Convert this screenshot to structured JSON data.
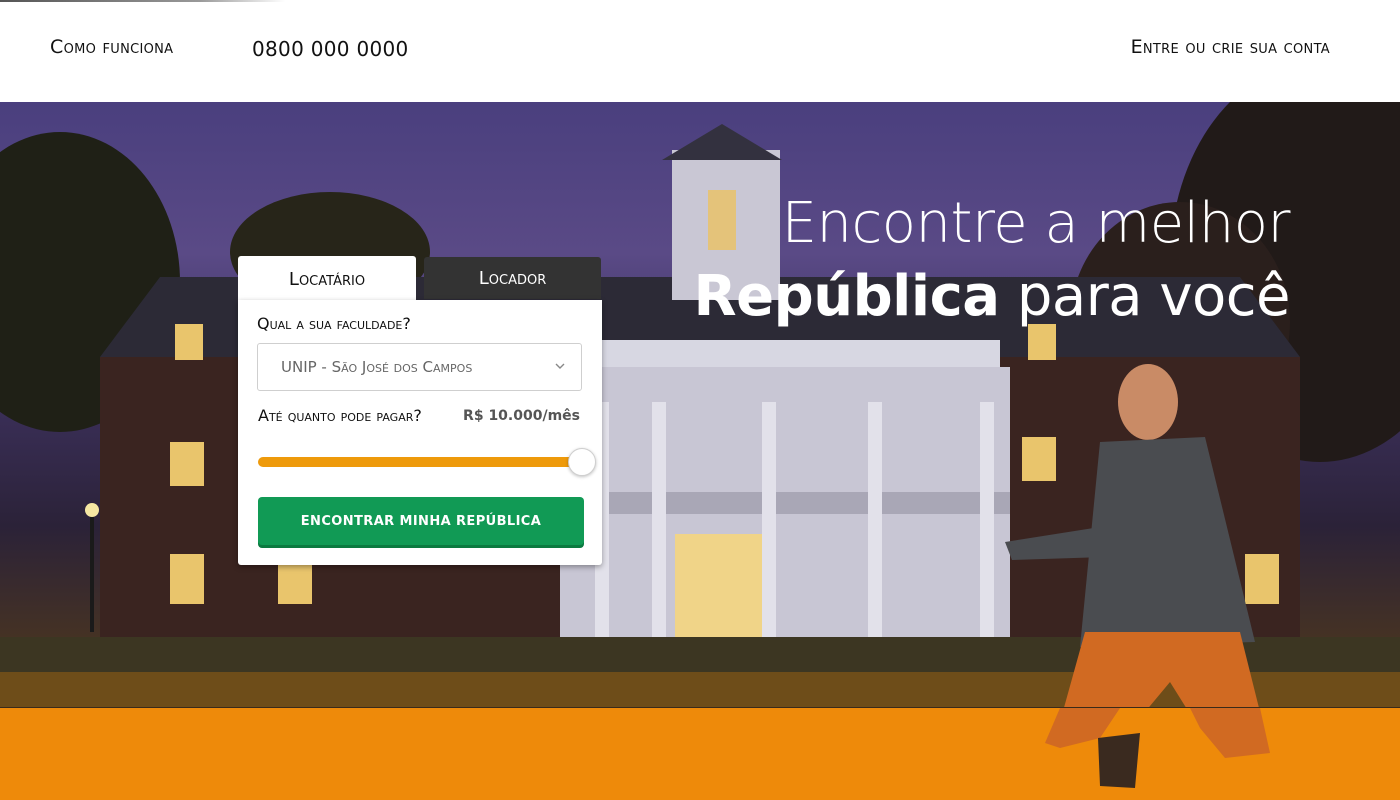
{
  "header": {
    "nav_how": "Como funciona",
    "phone": "0800 000 0000",
    "account": "Entre ou crie sua conta"
  },
  "hero": {
    "line1": "Encontre a melhor",
    "line2_bold": "República",
    "line2_rest": " para você"
  },
  "search": {
    "tabs": [
      {
        "label": "Locatário",
        "active": true
      },
      {
        "label": "Locador",
        "active": false
      }
    ],
    "college_label": "Qual a sua faculdade?",
    "college_value": "UNIP - São José dos Campos",
    "price_label": "Até quanto pode pagar?",
    "price_value": "R$ 10.000/mês",
    "slider_fraction": 1.0,
    "button_label": "ENCONTRAR MINHA REPÚBLICA"
  },
  "colors": {
    "accent_orange": "#ee8a0a",
    "button_green": "#119a55",
    "dark_tab": "#333333"
  },
  "icons": [
    "chevron-down-icon"
  ]
}
